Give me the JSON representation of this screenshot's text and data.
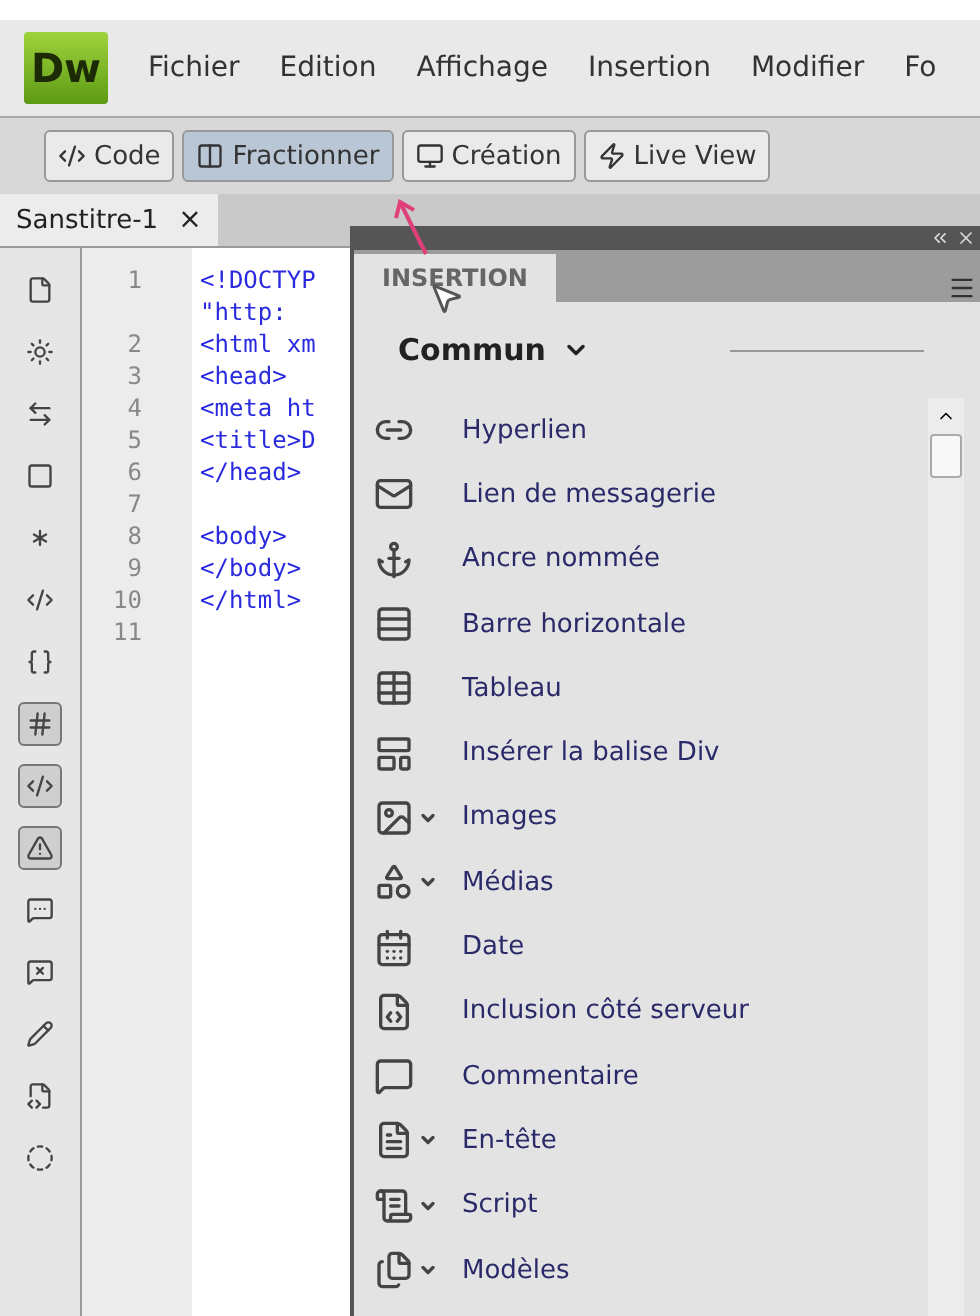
{
  "app": {
    "logo": "Dw"
  },
  "menu": [
    "Fichier",
    "Edition",
    "Affichage",
    "Insertion",
    "Modifier",
    "Fo"
  ],
  "view_buttons": [
    {
      "label": "Code",
      "selected": false
    },
    {
      "label": "Fractionner",
      "selected": true
    },
    {
      "label": "Création",
      "selected": false
    },
    {
      "label": "Live View",
      "selected": false
    }
  ],
  "document_tab": {
    "title": "Sanstitre-1",
    "close": "×"
  },
  "coding_toolbar": [
    {
      "on": false
    },
    {
      "on": false
    },
    {
      "on": false
    },
    {
      "on": false
    },
    {
      "on": false
    },
    {
      "on": false
    },
    {
      "on": false
    },
    {
      "on": true
    },
    {
      "on": true
    },
    {
      "on": true
    },
    {
      "on": false
    },
    {
      "on": false
    },
    {
      "on": false
    },
    {
      "on": false
    },
    {
      "on": false
    }
  ],
  "code_lines": [
    {
      "number": "1",
      "code": "<!DOCTYP"
    },
    {
      "code": "\"http:"
    },
    {
      "number": "2",
      "code": "<html xm"
    },
    {
      "number": "3",
      "code": "<head>"
    },
    {
      "number": "4",
      "code": "<meta ht"
    },
    {
      "number": "5",
      "code": "<title>D"
    },
    {
      "number": "6",
      "code": "</head>"
    },
    {
      "number": "7"
    },
    {
      "number": "8",
      "code": "<body>"
    },
    {
      "number": "9",
      "code": "</body>"
    },
    {
      "number": "10",
      "code": "</html>"
    },
    {
      "number": "11"
    }
  ],
  "insert_panel": {
    "tab": "INSERTION",
    "category": "Commun",
    "items": [
      {
        "label": "Hyperlien",
        "has_menu": false
      },
      {
        "label": "Lien de messagerie",
        "has_menu": false
      },
      {
        "label": "Ancre nommée",
        "has_menu": false
      },
      {
        "label": "Barre horizontale",
        "has_menu": false
      },
      {
        "label": "Tableau",
        "has_menu": false
      },
      {
        "label": "Insérer la balise Div",
        "has_menu": false
      },
      {
        "label": "Images",
        "has_menu": true
      },
      {
        "label": "Médias",
        "has_menu": true
      },
      {
        "label": "Date",
        "has_menu": false
      },
      {
        "label": "Inclusion côté serveur",
        "has_menu": false
      },
      {
        "label": "Commentaire",
        "has_menu": false
      },
      {
        "label": "En-tête",
        "has_menu": true
      },
      {
        "label": "Script",
        "has_menu": true
      },
      {
        "label": "Modèles",
        "has_menu": true
      }
    ]
  }
}
